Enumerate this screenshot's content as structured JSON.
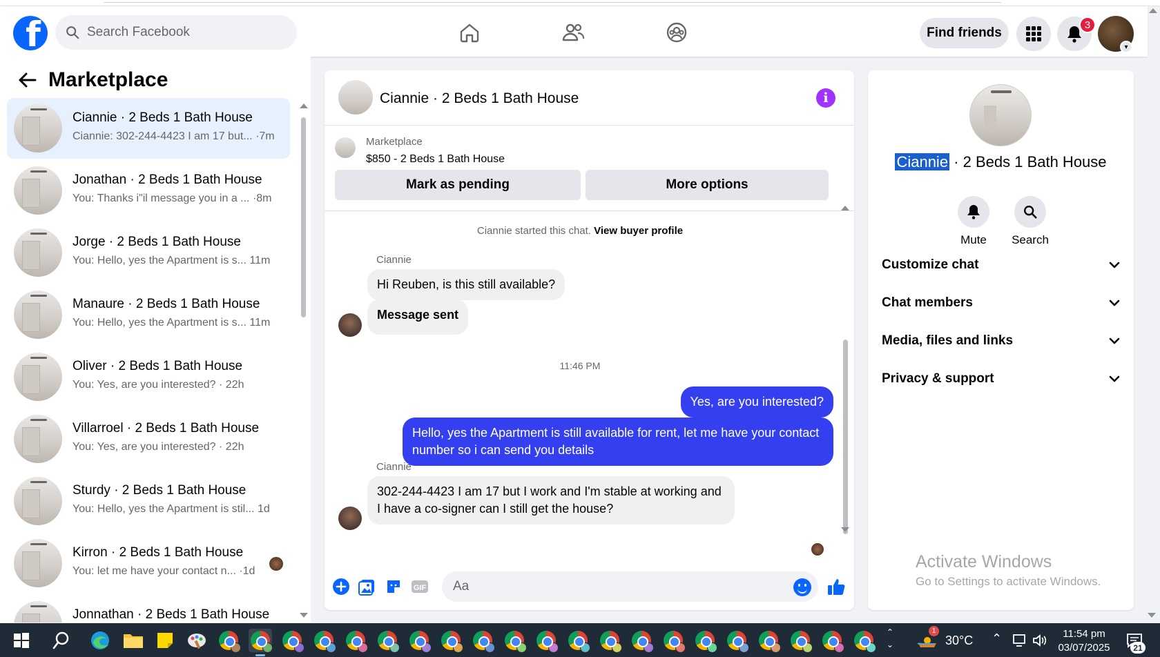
{
  "topbar": {
    "logo_letter": "f",
    "search_placeholder": "Search Facebook",
    "find_friends": "Find friends",
    "notifications_count": "3"
  },
  "sidebar": {
    "title": "Marketplace",
    "conversations": [
      {
        "title": "Ciannie · 2 Beds 1 Bath House",
        "preview": "Ciannie: 302-244-4423 I am 17 but... ·7m",
        "active": true
      },
      {
        "title": "Jonathan · 2 Beds 1 Bath House",
        "preview": "You: Thanks i\"il message you in a ... ·8m"
      },
      {
        "title": "Jorge · 2 Beds 1 Bath House",
        "preview": "You: Hello, yes the Apartment is s... 11m"
      },
      {
        "title": "Manaure · 2 Beds 1 Bath House",
        "preview": "You: Hello, yes the Apartment is s... 11m"
      },
      {
        "title": "Oliver · 2 Beds 1 Bath House",
        "preview": "You: Yes, are you interested? · 22h"
      },
      {
        "title": "Villarroel · 2 Beds 1 Bath House",
        "preview": "You: Yes, are you interested? · 22h"
      },
      {
        "title": "Sturdy · 2 Beds 1 Bath House",
        "preview": "You: Hello, yes the Apartment is stil... 1d"
      },
      {
        "title": "Kirron · 2 Beds 1 Bath House",
        "preview": "You: let me have your contact n... ·1d"
      },
      {
        "title": "Jonnathan · 2 Beds 1 Bath House",
        "preview": ""
      }
    ]
  },
  "chat": {
    "header_title": "Ciannie · 2 Beds 1 Bath House",
    "listing": {
      "source": "Marketplace",
      "price_title": "$850 - 2 Beds 1 Bath House",
      "mark_pending": "Mark as pending",
      "more_options": "More options"
    },
    "system_text": "Ciannie started this chat.",
    "system_link": "View buyer profile",
    "sender_name_1": "Ciannie",
    "msg_1": "Hi Reuben, is this still available?",
    "msg_2": "Message sent",
    "timestamp": "11:46 PM",
    "msg_3": "Yes, are you interested?",
    "msg_4": "Hello, yes the Apartment is still available for rent, let me have your contact number so i can send you details",
    "sender_name_2": "Ciannie",
    "msg_5": "302-244-4423 I am 17 but I work and I'm stable at working and I have a co-signer can I still get the house?",
    "composer_placeholder": "Aa"
  },
  "details": {
    "name_highlight": "Ciannie",
    "name_rest": " · 2 Beds 1 Bath House",
    "mute_label": "Mute",
    "search_label": "Search",
    "sections": [
      "Customize chat",
      "Chat members",
      "Media, files and links",
      "Privacy & support"
    ]
  },
  "watermark": {
    "line1": "Activate Windows",
    "line2": "Go to Settings to activate Windows."
  },
  "taskbar": {
    "weather_badge": "1",
    "temperature": "30°C",
    "time": "11:54 pm",
    "date": "03/07/2025",
    "notif_count": "21"
  },
  "colors": {
    "fb_blue": "#0866ff",
    "outgoing_bubble": "#3440f0",
    "info_purple": "#a033ff",
    "badge_red": "#e41e3f"
  }
}
